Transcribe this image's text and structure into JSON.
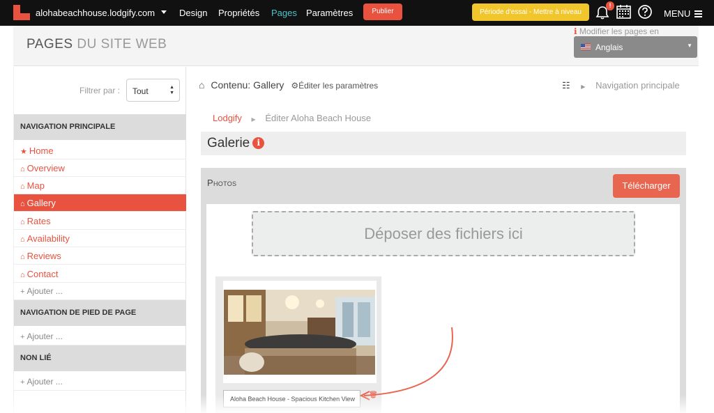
{
  "topbar": {
    "site_name": "alohabeachhouse.lodgify.com",
    "nav": [
      "Design",
      "Propriétés",
      "Pages",
      "Paramètres"
    ],
    "active_nav": "Pages",
    "publish_label": "Publier",
    "trial_label": "Période d'essai - Mettre à niveau",
    "notification_count": "!",
    "menu_label": "MENU",
    "icons": [
      "bell-icon",
      "calendar-icon",
      "help-icon",
      "hamburger-icon"
    ]
  },
  "header": {
    "title_part1": "PAGES",
    "title_part2": "DU SITE WEB",
    "lang_label": "Modifier les pages en",
    "lang_value": "Anglais"
  },
  "sidebar": {
    "filter_label": "Filtrer par :",
    "filter_value": "Tout",
    "sections": [
      {
        "title": "NAVIGATION PRINCIPALE",
        "items": [
          "Home",
          "Overview",
          "Map",
          "Gallery",
          "Rates",
          "Availability",
          "Reviews",
          "Contact"
        ],
        "add_label": "Ajouter ..."
      },
      {
        "title": "NAVIGATION DE PIED DE PAGE",
        "add_label": "Ajouter ..."
      },
      {
        "title": "NON LIÉ",
        "add_label": "Ajouter ..."
      }
    ],
    "active_item": "Gallery"
  },
  "main": {
    "content_label": "Contenu: Gallery",
    "edit_settings": "Éditer les paramètres",
    "nav_main": "Navigation principale",
    "breadcrumb": [
      "Lodgify",
      "Éditer Aloha Beach House"
    ],
    "gallery_title": "Galerie",
    "photos_title": "Photos",
    "upload_label": "Télécharger",
    "dropzone_text": "Déposer des fichiers ici",
    "photo_caption": "Aloha Beach House - Spacious Kitchen View"
  },
  "colors": {
    "accent": "#e8523f",
    "topbar": "#111111",
    "trial": "#f1c52c",
    "active_nav": "#4fc3c8"
  }
}
